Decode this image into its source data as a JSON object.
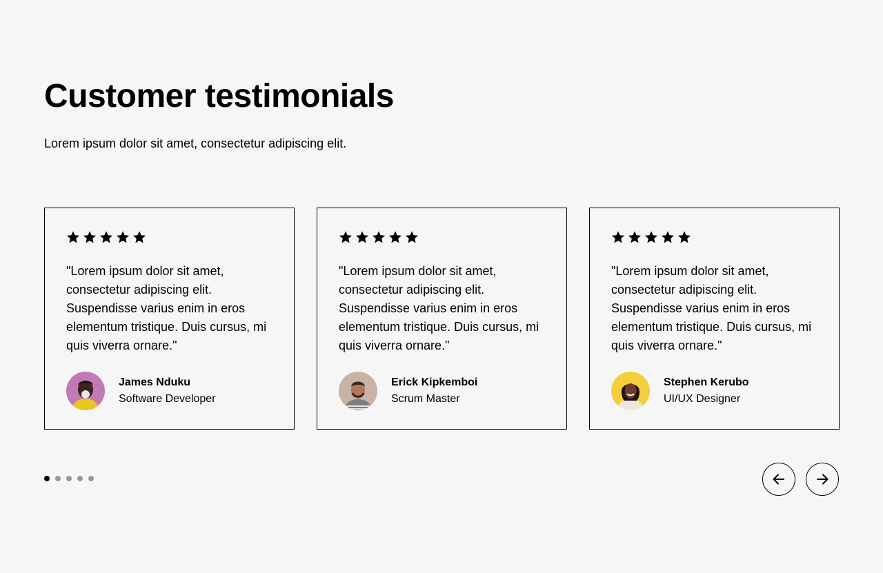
{
  "heading": {
    "title": "Customer testimonials",
    "subtitle": "Lorem ipsum dolor sit amet, consectetur adipiscing elit."
  },
  "testimonials": [
    {
      "rating": 5,
      "quote": "\"Lorem ipsum dolor sit amet, consectetur adipiscing elit. Suspendisse varius enim in eros elementum tristique. Duis cursus, mi quis viverra ornare.\"",
      "name": "James Nduku",
      "role": "Software Developer",
      "avatar_bg": "#c07bb4"
    },
    {
      "rating": 5,
      "quote": "\"Lorem ipsum dolor sit amet, consectetur adipiscing elit. Suspendisse varius enim in eros elementum tristique. Duis cursus, mi quis viverra ornare.\"",
      "name": "Erick Kipkemboi",
      "role": "Scrum Master",
      "avatar_bg": "#c9b3a5"
    },
    {
      "rating": 5,
      "quote": "\"Lorem ipsum dolor sit amet, consectetur adipiscing elit. Suspendisse varius enim in eros elementum tristique. Duis cursus, mi quis viverra ornare.\"",
      "name": "Stephen Kerubo",
      "role": "UI/UX Designer",
      "avatar_bg": "#f4cf3c"
    }
  ],
  "pagination": {
    "count": 5,
    "active_index": 0
  },
  "navigation": {
    "prev_icon": "arrow-left-icon",
    "next_icon": "arrow-right-icon"
  },
  "colors": {
    "background": "#f6f6f6",
    "text": "#000000",
    "dot_inactive": "#999999"
  }
}
